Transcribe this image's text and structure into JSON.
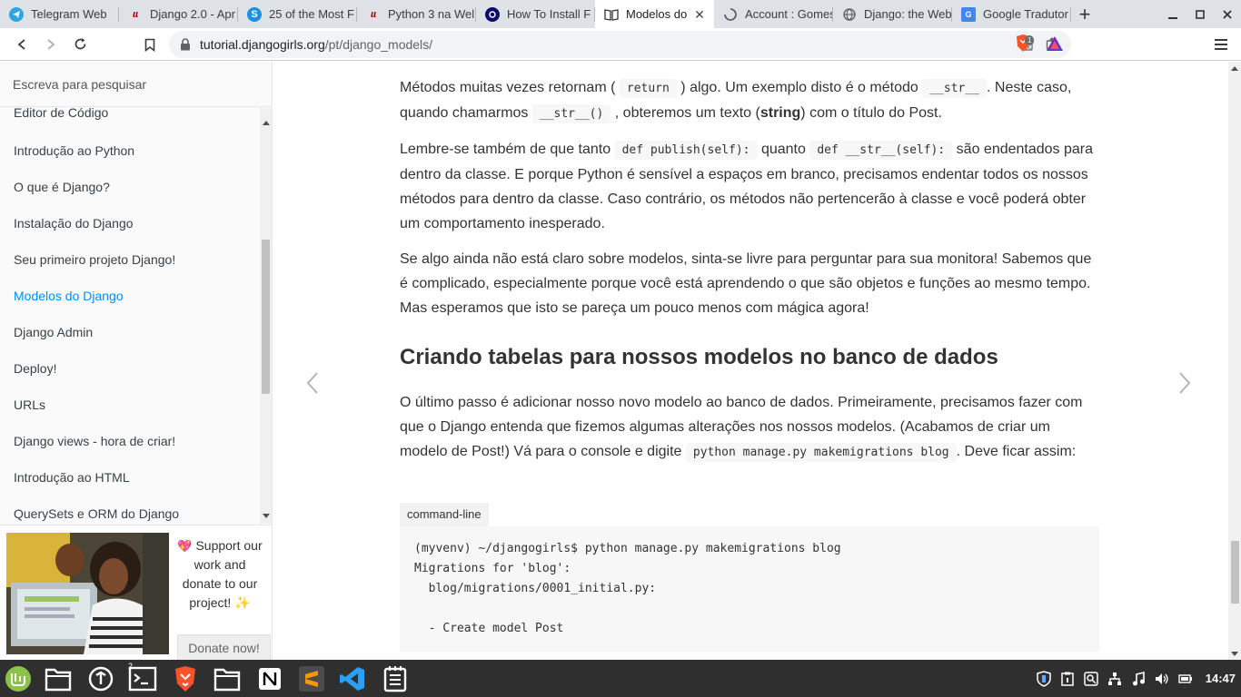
{
  "browser": {
    "tabs": [
      {
        "title": "Telegram Web",
        "icon": "telegram-icon",
        "active": false
      },
      {
        "title": "Django 2.0 - Apr",
        "icon": "django-rest-icon",
        "active": false
      },
      {
        "title": "25 of the Most F",
        "icon": "s-icon",
        "active": false
      },
      {
        "title": "Python 3 na Wel",
        "icon": "django-rest-icon",
        "active": false
      },
      {
        "title": "How To Install F",
        "icon": "digitalocean-icon",
        "active": false
      },
      {
        "title": "Modelos do",
        "icon": "book-icon",
        "active": true
      },
      {
        "title": "Account : Gomes",
        "icon": "spinner-icon",
        "active": false
      },
      {
        "title": "Django: the Web",
        "icon": "globe-icon",
        "active": false
      },
      {
        "title": "Google Tradutor",
        "icon": "translate-icon",
        "active": false
      }
    ],
    "new_tab_label": "+",
    "url_domain": "tutorial.djangogirls.org",
    "url_path": "/pt/django_models/",
    "brave_badge": "1"
  },
  "sidebar": {
    "search_placeholder": "Escreva para pesquisar",
    "items": [
      {
        "label": "Editor de Código",
        "active": false
      },
      {
        "label": "Introdução ao Python",
        "active": false
      },
      {
        "label": "O que é Django?",
        "active": false
      },
      {
        "label": "Instalação do Django",
        "active": false
      },
      {
        "label": "Seu primeiro projeto Django!",
        "active": false
      },
      {
        "label": "Modelos do Django",
        "active": true
      },
      {
        "label": "Django Admin",
        "active": false
      },
      {
        "label": "Deploy!",
        "active": false
      },
      {
        "label": "URLs",
        "active": false
      },
      {
        "label": "Django views - hora de criar!",
        "active": false
      },
      {
        "label": "Introdução ao HTML",
        "active": false
      },
      {
        "label": "QuerySets e ORM do Django",
        "active": false
      }
    ],
    "sponsor": {
      "heart": "💖",
      "text": "Support our work and donate to our project!",
      "sparkle": "✨",
      "donate_label": "Donate now!"
    }
  },
  "content": {
    "p1": {
      "t1": "Métodos muitas vezes retornam (",
      "c1": "return",
      "t2": ") algo. Um exemplo disto é o método",
      "c2": "__str__",
      "t3": ". Neste caso, quando chamarmos",
      "c3": "__str__()",
      "t4": ", obteremos um texto (",
      "strong": "string",
      "t5": ") com o título do Post."
    },
    "p2": {
      "t1": "Lembre-se também de que tanto",
      "c1": "def publish(self):",
      "t2": "quanto",
      "c2": "def __str__(self):",
      "t3": "são endentados para dentro da classe. E porque Python é sensível a espaços em branco, precisamos endentar todos os nossos métodos para dentro da classe. Caso contrário, os métodos não pertencerão à classe e você poderá obter um comportamento inesperado."
    },
    "p3": "Se algo ainda não está claro sobre modelos, sinta-se livre para perguntar para sua monitora! Sabemos que é complicado, especialmente porque você está aprendendo o que são objetos e funções ao mesmo tempo. Mas esperamos que isto se pareça um pouco menos com mágica agora!",
    "heading": "Criando tabelas para nossos modelos no banco de dados",
    "p4": {
      "t1": "O último passo é adicionar nosso novo modelo ao banco de dados. Primeiramente, precisamos fazer com que o Django entenda que fizemos algumas alterações nos nossos modelos. (Acabamos de criar um modelo de Post!) Vá para o console e digite",
      "c1": "python manage.py makemigrations blog",
      "t2": ". Deve ficar assim:"
    },
    "code_label": "command-line",
    "code_lines": [
      "(myvenv) ~/djangogirls$ python manage.py makemigrations blog",
      "Migrations for 'blog':",
      "  blog/migrations/0001_initial.py:",
      "",
      "  - Create model Post"
    ]
  },
  "taskbar": {
    "apps": [
      "mint-menu-icon",
      "files-icon",
      "update-manager-icon",
      "terminal-icon",
      "brave-icon",
      "folder-icon",
      "notion-icon",
      "sublime-icon",
      "vscode-icon",
      "notes-icon"
    ],
    "terminal_badge": "2",
    "clock": "14:47"
  }
}
